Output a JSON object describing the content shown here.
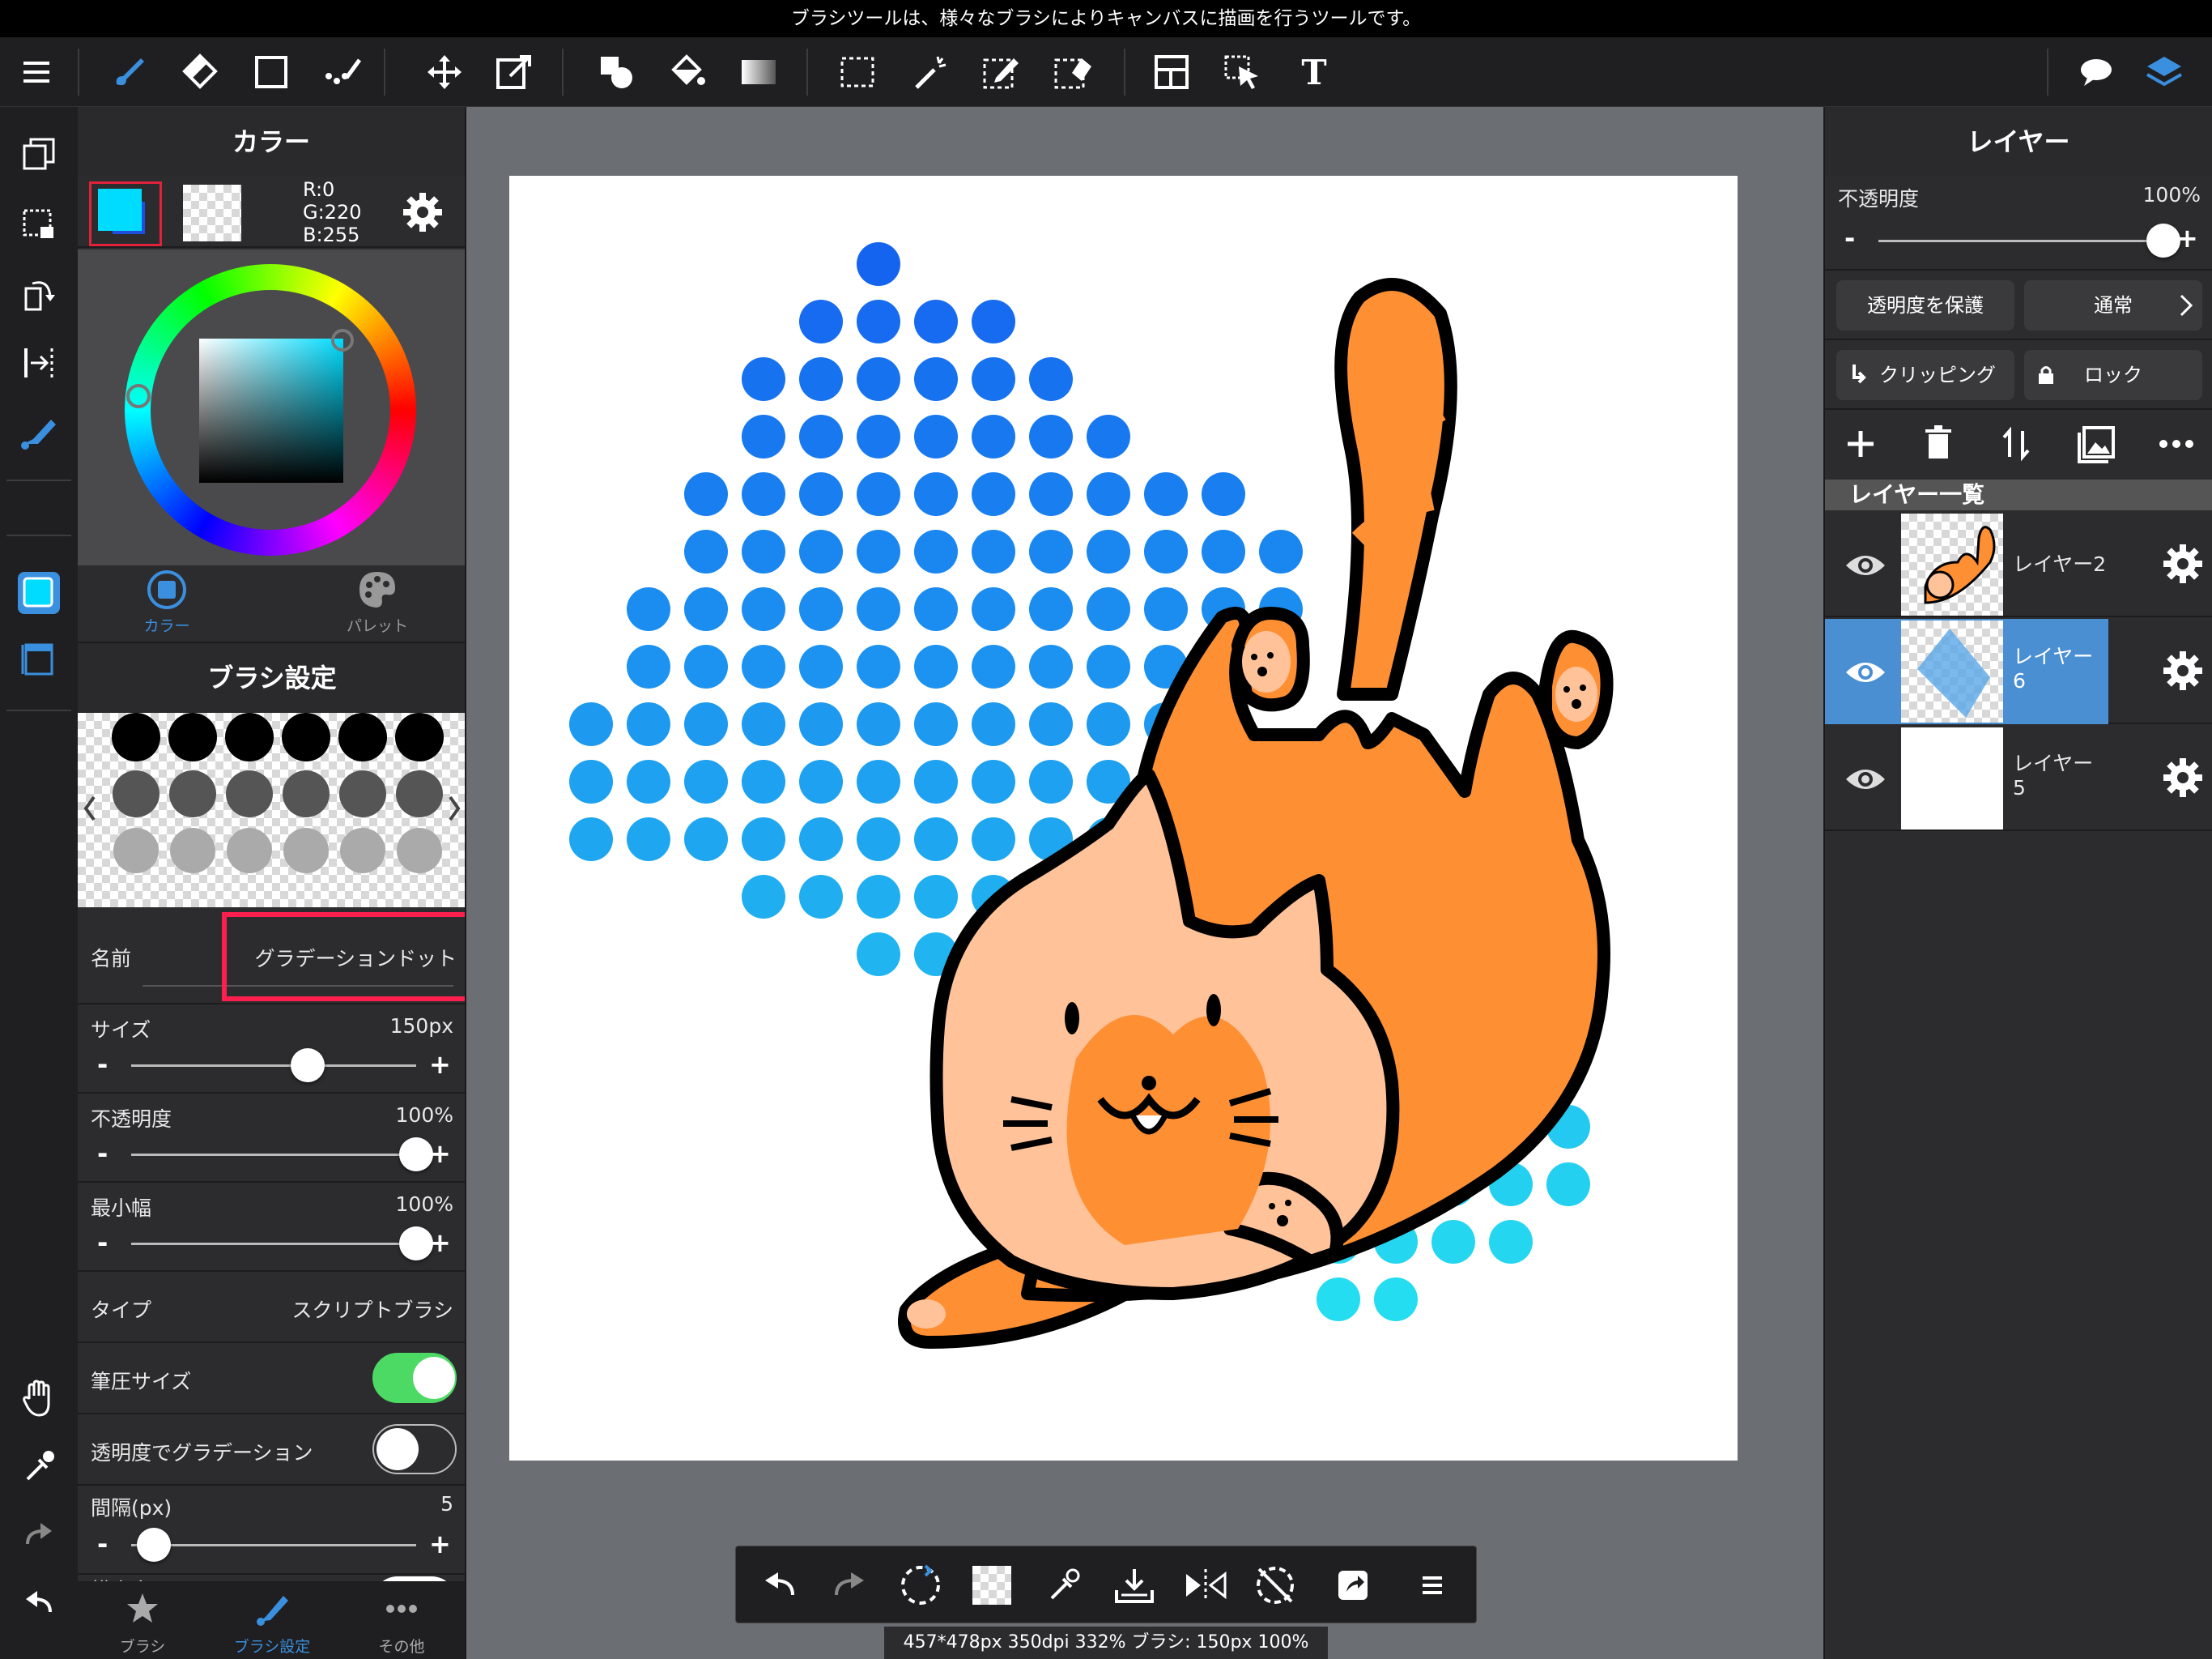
{
  "hint_text": "ブラシツールは、様々なブラシによりキャンバスに描画を行うツールです。",
  "colors": {
    "accent": "#3a8fde",
    "current": "#00dcff",
    "highlight_box": "#ff1f4f",
    "toggle_on": "#4cd964",
    "layer_selected": "#4a8fd2"
  },
  "top_icons": [
    "menu-icon",
    "brush-icon",
    "eraser-icon",
    "rectangle-icon",
    "dot-brush-icon",
    "move-icon",
    "transform-icon",
    "fill-shape-icon",
    "bucket-icon",
    "gradient-icon",
    "select-rect-icon",
    "magic-wand-icon",
    "select-pen-icon",
    "select-eraser-icon",
    "frame-divider-icon",
    "operation-icon",
    "text-icon",
    "speech-bubble-icon",
    "layers-icon"
  ],
  "color_panel": {
    "title": "カラー",
    "r": "R:0",
    "g": "G:220",
    "b": "B:255",
    "tab_color": "カラー",
    "tab_palette": "パレット"
  },
  "brush_settings": {
    "title": "ブラシ設定",
    "name_label": "名前",
    "name_value": "グラデーションドット",
    "size_label": "サイズ",
    "size_value": "150px",
    "size_level": 0.62,
    "opacity_label": "不透明度",
    "opacity_value": "100%",
    "opacity_level": 1.0,
    "minwidth_label": "最小幅",
    "minwidth_value": "100%",
    "minwidth_level": 1.0,
    "type_label": "タイプ",
    "type_value": "スクリプトブラシ",
    "pressure_label": "筆圧サイズ",
    "pressure_on": true,
    "gradation_label": "透明度でグラデーション",
    "gradation_on": false,
    "spacing_label": "間隔(px)",
    "spacing_value": "5",
    "spacing_level": 0.08,
    "cut_label": "横方向"
  },
  "left_tabs": {
    "brush": "ブラシ",
    "brush_settings": "ブラシ設定",
    "other": "その他"
  },
  "layer_panel": {
    "title": "レイヤー",
    "opacity_label": "不透明度",
    "opacity_value": "100%",
    "opacity_level": 1.0,
    "protect_label": "透明度を保護",
    "blend_label": "通常",
    "clipping_label": "クリッピング",
    "lock_label": "ロック",
    "list_title": "レイヤー一覧",
    "layers": [
      {
        "name": "レイヤー2",
        "selected": false
      },
      {
        "name": "レイヤー\n6",
        "selected": true
      },
      {
        "name": "レイヤー\n5",
        "selected": false
      }
    ]
  },
  "status_text": "457*478px 350dpi 332% ブラシ: 150px 100%"
}
